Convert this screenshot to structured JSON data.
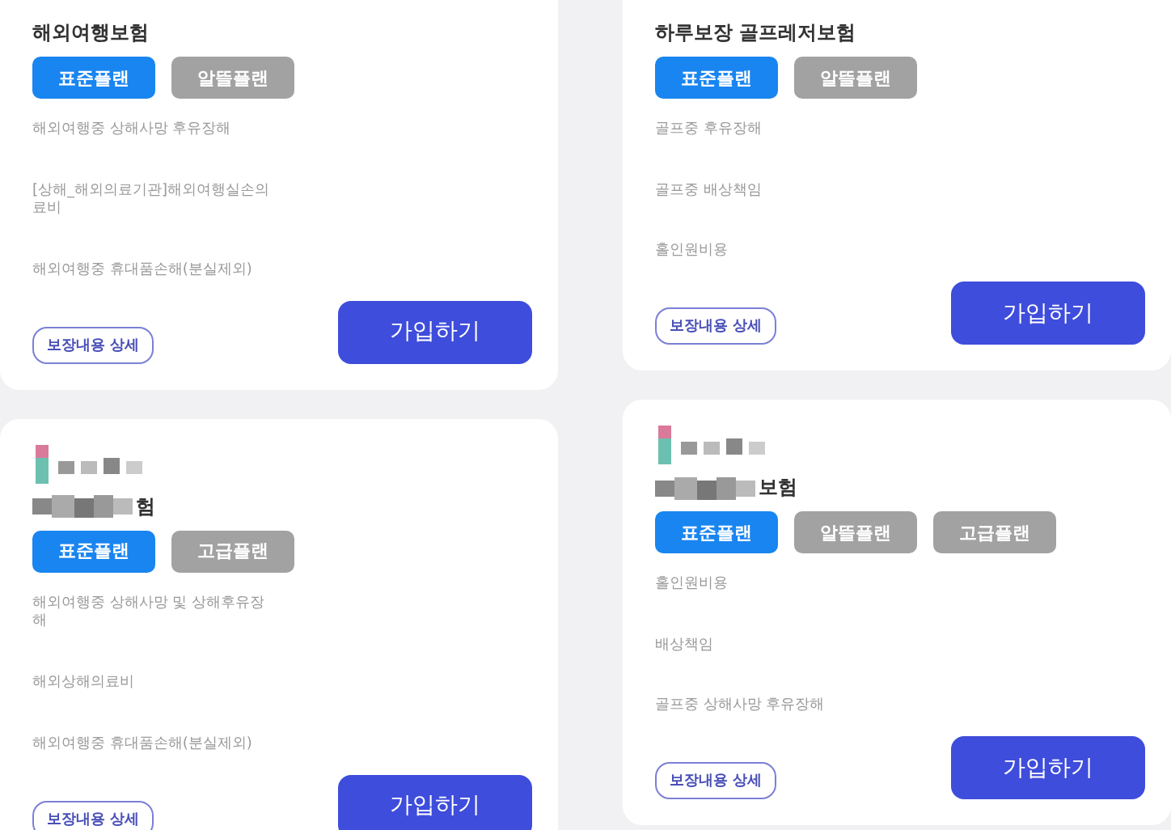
{
  "columns": [
    {
      "cards": [
        {
          "kind": "plain",
          "title": "해외여행보험",
          "plans": [
            {
              "label": "표준플랜",
              "selected": true
            },
            {
              "label": "알뜰플랜",
              "selected": false
            }
          ],
          "coverages": [
            "해외여행중 상해사망 후유장해",
            "[상해_해외의료기관]해외여행실손의료비",
            "해외여행중 휴대품손해(분실제외)"
          ],
          "detail_button": "보장내용 상세",
          "join_button": "가입하기"
        },
        {
          "kind": "masked",
          "title": "험",
          "plans": [
            {
              "label": "표준플랜",
              "selected": true
            },
            {
              "label": "고급플랜",
              "selected": false
            }
          ],
          "coverages": [
            "해외여행중 상해사망 및 상해후유장해",
            "해외상해의료비",
            "해외여행중 휴대품손해(분실제외)"
          ],
          "detail_button": "보장내용 상세",
          "join_button": "가입하기"
        }
      ]
    },
    {
      "cards": [
        {
          "kind": "plain",
          "title": "하루보장 골프레저보험",
          "plans": [
            {
              "label": "표준플랜",
              "selected": true
            },
            {
              "label": "알뜰플랜",
              "selected": false
            }
          ],
          "coverages": [
            "골프중 후유장해",
            "골프중 배상책임",
            "홀인원비용"
          ],
          "detail_button": "보장내용 상세",
          "join_button": "가입하기"
        },
        {
          "kind": "masked",
          "title": "보험",
          "plans": [
            {
              "label": "표준플랜",
              "selected": true
            },
            {
              "label": "알뜰플랜",
              "selected": false
            },
            {
              "label": "고급플랜",
              "selected": false
            }
          ],
          "coverages": [
            "홀인원비용",
            "배상책임",
            "골프중 상해사망 후유장해"
          ],
          "detail_button": "보장내용 상세",
          "join_button": "가입하기"
        }
      ]
    }
  ]
}
